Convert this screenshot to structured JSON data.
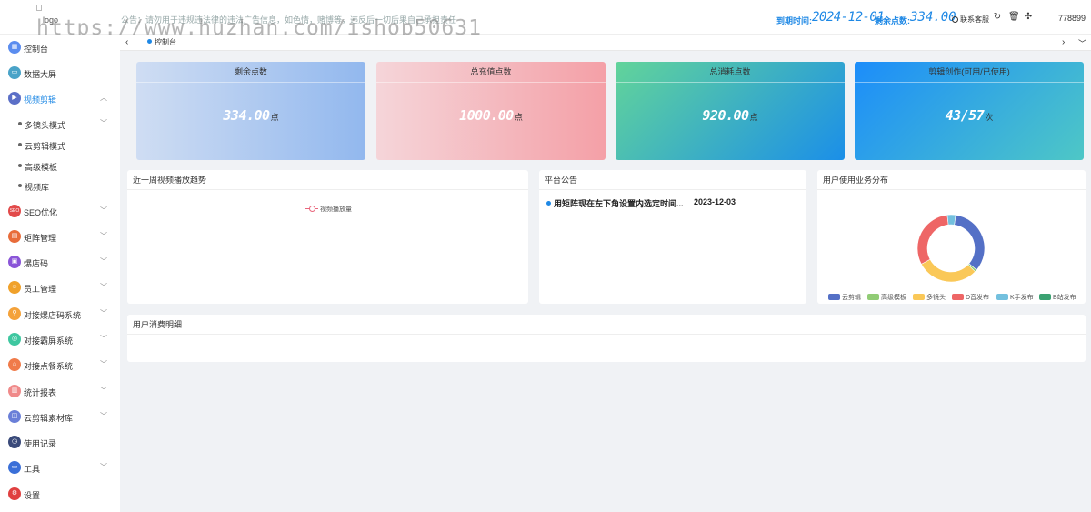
{
  "header": {
    "logo_alt": "logo",
    "notice": "公告：请勿用于违规违法律的违法广告信息，如色情，赌博等，违反后一切后果自己承担责任",
    "watermark": "https://www.huzhan.com/ishop50631",
    "expire_label": "到期时间:",
    "expire_value": "2024-12-01",
    "points_label": "剩余点数:",
    "points_value": "334.00",
    "service": "联系客服",
    "user": "778899",
    "icons": [
      "refresh-icon",
      "trash-icon",
      "fullscreen-icon"
    ]
  },
  "sidebar": {
    "items": [
      {
        "label": "控制台",
        "icon": "dashboard-icon",
        "color": "#5b8def"
      },
      {
        "label": "数据大屏",
        "icon": "screen-icon",
        "color": "#4aa3c8"
      },
      {
        "label": "视频剪辑",
        "icon": "video-edit-icon",
        "color": "#5b6fc7"
      },
      {
        "label": "多镜头模式"
      },
      {
        "label": "云剪辑模式"
      },
      {
        "label": "高级模板"
      },
      {
        "label": "视频库"
      },
      {
        "label": "SEO优化",
        "icon": "seo-icon",
        "color": "#e24a4a"
      },
      {
        "label": "矩阵管理",
        "icon": "matrix-icon",
        "color": "#e86c3a"
      },
      {
        "label": "爆店码",
        "icon": "qrcode-icon",
        "color": "#8a55d8"
      },
      {
        "label": "员工管理",
        "icon": "staff-icon",
        "color": "#f0a12a"
      },
      {
        "label": "对接爆店码系统",
        "icon": "link-icon",
        "color": "#f4a23a"
      },
      {
        "label": "对接霸屏系统",
        "icon": "screen-link-icon",
        "color": "#3ec7a0"
      },
      {
        "label": "对接点餐系统",
        "icon": "food-icon",
        "color": "#f07b4a"
      },
      {
        "label": "统计报表",
        "icon": "report-icon",
        "color": "#f08a8a"
      },
      {
        "label": "云剪辑素材库",
        "icon": "library-icon",
        "color": "#6a7fd8"
      },
      {
        "label": "使用记录",
        "icon": "record-icon",
        "color": "#3a4a7a"
      },
      {
        "label": "工具",
        "icon": "tool-icon",
        "color": "#3a6fd8"
      },
      {
        "label": "设置",
        "icon": "settings-icon",
        "color": "#e04040"
      }
    ]
  },
  "tabs": {
    "active": "控制台"
  },
  "cards": [
    {
      "title": "剩余点数",
      "value": "334.00",
      "unit": "点"
    },
    {
      "title": "总充值点数",
      "value": "1000.00",
      "unit": "点"
    },
    {
      "title": "总消耗点数",
      "value": "920.00",
      "unit": "点"
    },
    {
      "title": "剪辑创作(可用/已使用)",
      "value": "43/57",
      "unit": "次"
    }
  ],
  "panels": {
    "trend_title": "近一周视频播放趋势",
    "trend_legend": "视频播放量",
    "notice_title": "平台公告",
    "notice_text": "用矩阵现在左下角设置内选定时间...",
    "notice_date": "2023-12-03",
    "dist_title": "用户使用业务分布",
    "detail_title": "用户消费明细"
  },
  "chart_data": {
    "type": "pie",
    "categories": [
      "云剪辑",
      "高级模板",
      "多镜头",
      "D音发布",
      "K手发布",
      "B站发布"
    ],
    "values": [
      34,
      1,
      30,
      31,
      4,
      0
    ],
    "colors": [
      "#5470c6",
      "#91cc75",
      "#fac858",
      "#ee6666",
      "#73c0de",
      "#3ba272"
    ]
  }
}
